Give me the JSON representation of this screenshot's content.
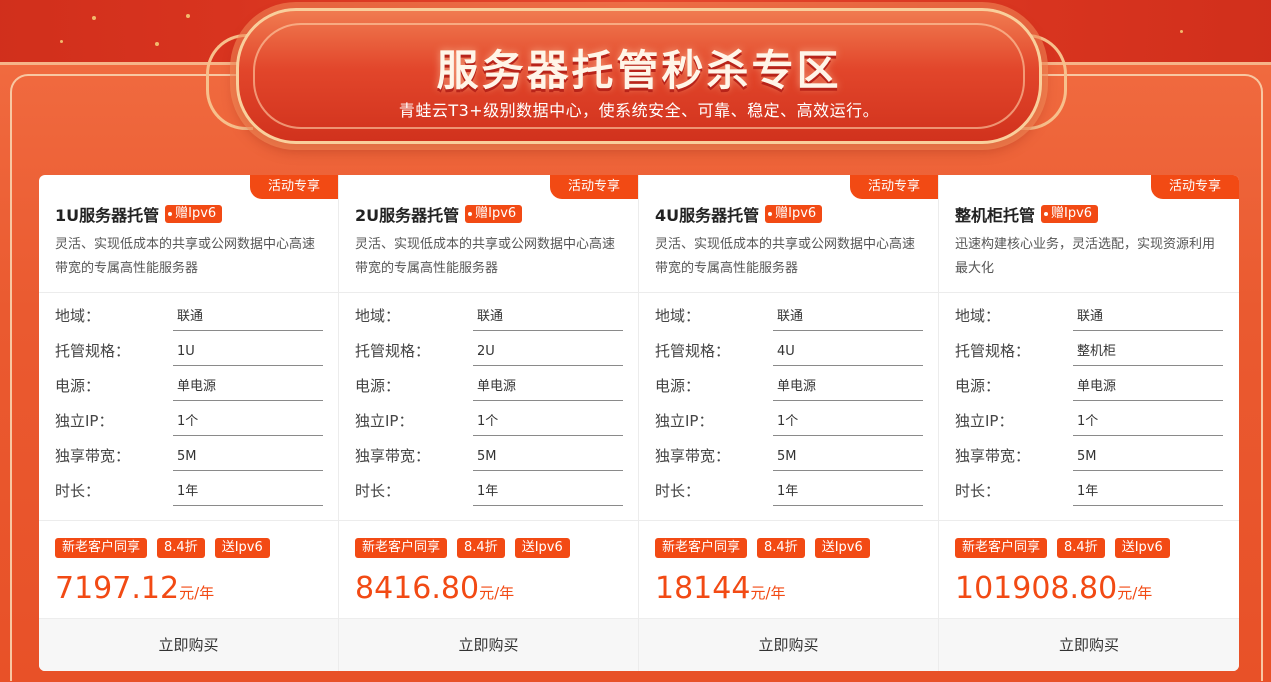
{
  "banner": {
    "title": "服务器托管秒杀专区",
    "subtitle": "青蛙云T3+级别数据中心，使系统安全、可靠、稳定、高效运行。"
  },
  "spec_labels": [
    "地域：",
    "托管规格：",
    "电源：",
    "独立IP：",
    "独享带宽：",
    "时长："
  ],
  "cards": [
    {
      "promo_tag": "活动专享",
      "name": "1U服务器托管",
      "ipv6_tag": "赠Ipv6",
      "description": "灵活、实现低成本的共享或公网数据中心高速带宽的专属高性能服务器",
      "specs": [
        "联通",
        "1U",
        "单电源",
        "1个",
        "5M",
        "1年"
      ],
      "badges": [
        "新老客户同享",
        "8.4折",
        "送Ipv6"
      ],
      "price": "7197.12",
      "price_unit": "元/年",
      "buy_label": "立即购买"
    },
    {
      "promo_tag": "活动专享",
      "name": "2U服务器托管",
      "ipv6_tag": "赠Ipv6",
      "description": "灵活、实现低成本的共享或公网数据中心高速带宽的专属高性能服务器",
      "specs": [
        "联通",
        "2U",
        "单电源",
        "1个",
        "5M",
        "1年"
      ],
      "badges": [
        "新老客户同享",
        "8.4折",
        "送Ipv6"
      ],
      "price": "8416.80",
      "price_unit": "元/年",
      "buy_label": "立即购买"
    },
    {
      "promo_tag": "活动专享",
      "name": "4U服务器托管",
      "ipv6_tag": "赠Ipv6",
      "description": "灵活、实现低成本的共享或公网数据中心高速带宽的专属高性能服务器",
      "specs": [
        "联通",
        "4U",
        "单电源",
        "1个",
        "5M",
        "1年"
      ],
      "badges": [
        "新老客户同享",
        "8.4折",
        "送Ipv6"
      ],
      "price": "18144",
      "price_unit": "元/年",
      "buy_label": "立即购买"
    },
    {
      "promo_tag": "活动专享",
      "name": "整机柜托管",
      "ipv6_tag": "赠Ipv6",
      "description": "迅速构建核心业务，灵活选配，实现资源利用最大化",
      "specs": [
        "联通",
        "整机柜",
        "单电源",
        "1个",
        "5M",
        "1年"
      ],
      "badges": [
        "新老客户同享",
        "8.4折",
        "送Ipv6"
      ],
      "price": "101908.80",
      "price_unit": "元/年",
      "buy_label": "立即购买"
    }
  ],
  "colors": {
    "accent": "#f24a14",
    "banner_red": "#d8341f",
    "border_gold": "#f9cf9c"
  }
}
